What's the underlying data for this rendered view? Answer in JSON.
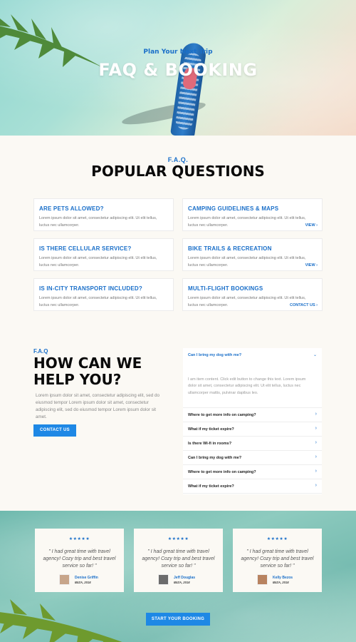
{
  "hero": {
    "subtitle": "Plan Your Next Trip",
    "title": "FAQ & BOOKING"
  },
  "popular": {
    "label": "F.A.Q.",
    "title": "POPULAR QUESTIONS",
    "cards": [
      {
        "title": "ARE PETS ALLOWED?",
        "body": "Lorem ipsum dolor sit amet, consectetur adipiscing elit. Ut elit tellus, luctus nec ullamcorper.",
        "action": ""
      },
      {
        "title": "CAMPING GUIDELINES & MAPS",
        "body": "Lorem ipsum dolor sit amet, consectetur adipiscing elit. Ut elit tellus, luctus nec ullamcorper.",
        "action": "VIEW  ›"
      },
      {
        "title": "IS THERE CELLULAR SERVICE?",
        "body": "Lorem ipsum dolor sit amet, consectetur adipiscing elit. Ut elit tellus, luctus nec ullamcorper.",
        "action": ""
      },
      {
        "title": "BIKE TRAILS & RECREATION",
        "body": "Lorem ipsum dolor sit amet, consectetur adipiscing elit. Ut elit tellus, luctus nec ullamcorper.",
        "action": "VIEW  ›"
      },
      {
        "title": "IS IN-CITY TRANSPORT INCLUDED?",
        "body": "Lorem ipsum dolor sit amet, consectetur adipiscing elit. Ut elit tellus, luctus nec ullamcorper.",
        "action": ""
      },
      {
        "title": "MULTI-FLIGHT BOOKINGS",
        "body": "Lorem ipsum dolor sit amet, consectetur adipiscing elit. Ut elit tellus, luctus nec ullamcorper.",
        "action": "CONTACT US  ›"
      }
    ]
  },
  "help": {
    "label": "F.A.Q",
    "title": "HOW CAN WE HELP YOU?",
    "text": "Lorem ipsum dolor sit amet, consectetur adipiscing elit, sed do eiusmod tempor Lorem ipsum dolor sit amet, consectetur adipiscing elit, sed do eiusmod tempor Lorem ipsum dolor sit amet.",
    "button": "CONTACT US"
  },
  "accordion": {
    "open_question": "Can I bring my dog with me?",
    "open_answer": "I am item content. Click edit button to change this text. Lorem ipsum dolor sit amet, consectetur adipiscing elit. Ut elit tellus, luctus nec ullamcorper mattis, pulvinar dapibus leo.",
    "items": [
      "Where to get more info on camping?",
      "What if my ticket expire?",
      "Is there Wi-fi in rooms?",
      "Can I bring my dog with me?",
      "Where to get more info on camping?",
      "What if my ticket expire?"
    ]
  },
  "testimonials": {
    "stars": "★★★★★",
    "cards": [
      {
        "quote": "\" I had great time with travel agency! Cozy trip and best travel service so far! \"",
        "name": "Denise Griffin",
        "location": "IBIZA, 2018"
      },
      {
        "quote": "\" I had great time with travel agency! Cozy trip and best travel service so far! \"",
        "name": "Jeff Douglas",
        "location": "IBIZA, 2018"
      },
      {
        "quote": "\" I had great time with travel agency! Cozy trip and best travel service so far! \"",
        "name": "Kelly Bezos",
        "location": "IBIZA, 2018"
      }
    ],
    "button": "START YOUR BOOKING"
  },
  "colors": {
    "accent": "#1a6fc9",
    "button": "#1e88e5",
    "background": "#fbf9f4"
  }
}
